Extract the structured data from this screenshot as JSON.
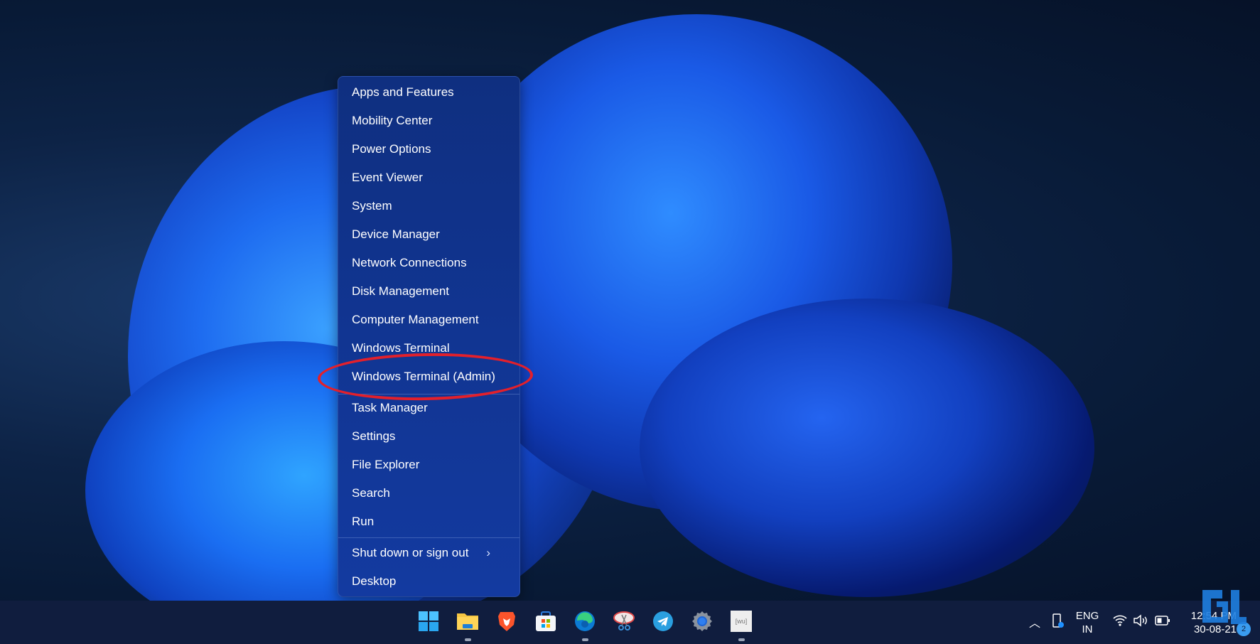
{
  "context_menu": {
    "items": [
      {
        "label": "Apps and Features"
      },
      {
        "label": "Mobility Center"
      },
      {
        "label": "Power Options"
      },
      {
        "label": "Event Viewer"
      },
      {
        "label": "System"
      },
      {
        "label": "Device Manager"
      },
      {
        "label": "Network Connections"
      },
      {
        "label": "Disk Management"
      },
      {
        "label": "Computer Management"
      },
      {
        "label": "Windows Terminal"
      },
      {
        "label": "Windows Terminal (Admin)",
        "highlighted": true
      },
      {
        "label": "Task Manager"
      },
      {
        "label": "Settings"
      },
      {
        "label": "File Explorer"
      },
      {
        "label": "Search"
      },
      {
        "label": "Run"
      },
      {
        "label": "Shut down or sign out",
        "submenu": true
      },
      {
        "label": "Desktop"
      }
    ],
    "submenu_chevron": "›"
  },
  "annotation": {
    "color": "#e3202b",
    "target": "Windows Terminal (Admin)"
  },
  "taskbar": {
    "apps": [
      {
        "name": "start",
        "icon": "windows-start-icon",
        "running": false
      },
      {
        "name": "file-explorer",
        "icon": "folder-icon",
        "running": true
      },
      {
        "name": "brave",
        "icon": "brave-lion-icon",
        "running": false
      },
      {
        "name": "microsoft-store",
        "icon": "store-bag-icon",
        "running": false
      },
      {
        "name": "edge",
        "icon": "edge-icon",
        "running": true
      },
      {
        "name": "snipping-tool",
        "icon": "scissors-icon",
        "running": false
      },
      {
        "name": "telegram",
        "icon": "telegram-plane-icon",
        "running": false
      },
      {
        "name": "settings",
        "icon": "gear-icon",
        "running": false
      },
      {
        "name": "app-wm",
        "icon": "wm-app-icon",
        "label": "[wu]",
        "running": true
      }
    ],
    "tray": {
      "overflow_chevron": "^",
      "language_line1": "ENG",
      "language_line2": "IN",
      "time": "12:54 PM",
      "date": "30-08-21",
      "notification_count": "2"
    }
  },
  "colors": {
    "accent": "#0078d4",
    "menu_bg": "#113592",
    "taskbar_bg": "#101d3e"
  }
}
